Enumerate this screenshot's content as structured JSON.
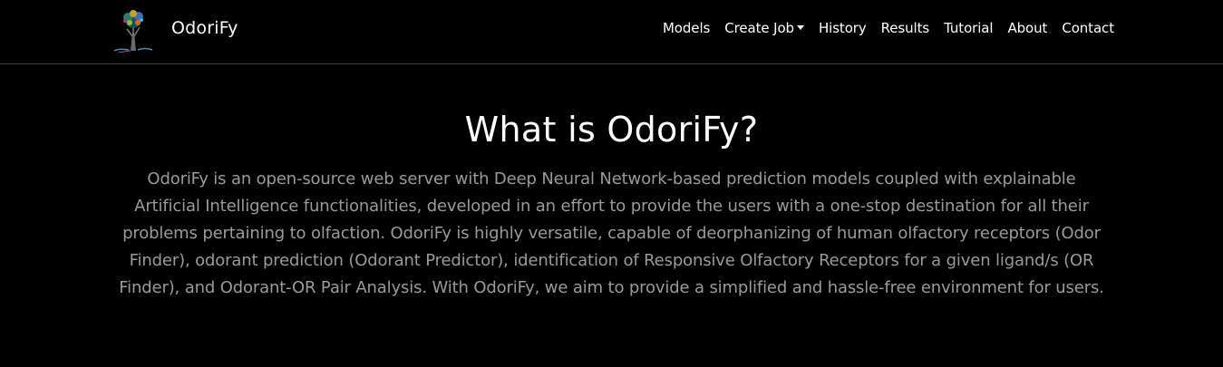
{
  "navbar": {
    "brand_name": "OdoriFy",
    "logo_icon": "tree-brain-logo-icon",
    "links": [
      {
        "label": "Models"
      },
      {
        "label": "Create Job",
        "has_dropdown": true
      },
      {
        "label": "History"
      },
      {
        "label": "Results"
      },
      {
        "label": "Tutorial"
      },
      {
        "label": "About"
      },
      {
        "label": "Contact"
      }
    ]
  },
  "main": {
    "title": "What is OdoriFy?",
    "description": "OdoriFy is an open-source web server with Deep Neural Network-based prediction models coupled with explainable Artificial Intelligence functionalities, developed in an effort to provide the users with a one-stop destination for all their problems pertaining to olfaction. OdoriFy is highly versatile, capable of deorphanizing of human olfactory receptors (Odor Finder), odorant prediction (Odorant Predictor), identification of Responsive Olfactory Receptors for a given ligand/s (OR Finder), and Odorant-OR Pair Analysis. With OdoriFy, we aim to provide a simplified and hassle-free environment for users."
  },
  "colors": {
    "background": "#000000",
    "nav_text": "#ffffff",
    "title_text": "#ffffff",
    "description_text": "#9a9a9a",
    "divider": "#3a3a3a"
  }
}
